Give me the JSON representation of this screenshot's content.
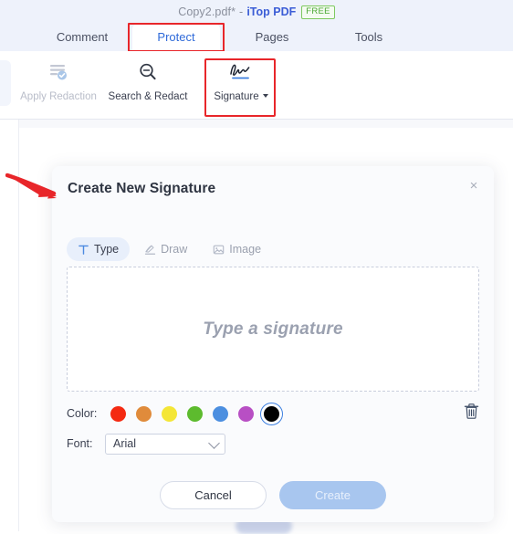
{
  "window": {
    "document_name": "Copy2.pdf*",
    "separator": "-",
    "app_name": "iTop PDF",
    "license_badge": "FREE"
  },
  "ribbon": {
    "tabs": [
      {
        "label": "Comment",
        "active": false
      },
      {
        "label": "Protect",
        "active": true
      },
      {
        "label": "Pages",
        "active": false
      },
      {
        "label": "Tools",
        "active": false
      }
    ],
    "highlighted_tab": "Protect"
  },
  "toolbar": {
    "items": [
      {
        "label": "Apply Redaction",
        "icon": "apply-redaction-icon",
        "enabled": false
      },
      {
        "label": "Search & Redact",
        "icon": "search-redact-icon",
        "enabled": true
      },
      {
        "label": "Signature",
        "icon": "signature-icon",
        "enabled": true,
        "has_dropdown": true
      }
    ],
    "highlighted_item": "Signature"
  },
  "dialog": {
    "title": "Create New Signature",
    "close_label": "×",
    "mode_tabs": [
      {
        "label": "Type",
        "icon": "type-text-icon",
        "active": true
      },
      {
        "label": "Draw",
        "icon": "draw-pen-icon",
        "active": false
      },
      {
        "label": "Image",
        "icon": "image-picture-icon",
        "active": false
      }
    ],
    "canvas": {
      "placeholder": "Type a signature",
      "value": ""
    },
    "color": {
      "label": "Color:",
      "options": [
        {
          "name": "red",
          "hex": "#F42A12",
          "selected": false
        },
        {
          "name": "orange",
          "hex": "#E08B3B",
          "selected": false
        },
        {
          "name": "yellow",
          "hex": "#F4E637",
          "selected": false
        },
        {
          "name": "green",
          "hex": "#5DBB2E",
          "selected": false
        },
        {
          "name": "blue",
          "hex": "#4C8FE0",
          "selected": false
        },
        {
          "name": "purple",
          "hex": "#B84FC4",
          "selected": false
        },
        {
          "name": "black",
          "hex": "#000000",
          "selected": true
        }
      ],
      "selected": "black"
    },
    "font": {
      "label": "Font:",
      "value": "Arial",
      "options": [
        "Arial"
      ]
    },
    "delete_icon": "trash-icon",
    "buttons": {
      "cancel": "Cancel",
      "create": "Create",
      "create_enabled": false
    }
  },
  "annotation": {
    "arrow_color": "#E8262A",
    "highlight_color": "#E8262A"
  }
}
